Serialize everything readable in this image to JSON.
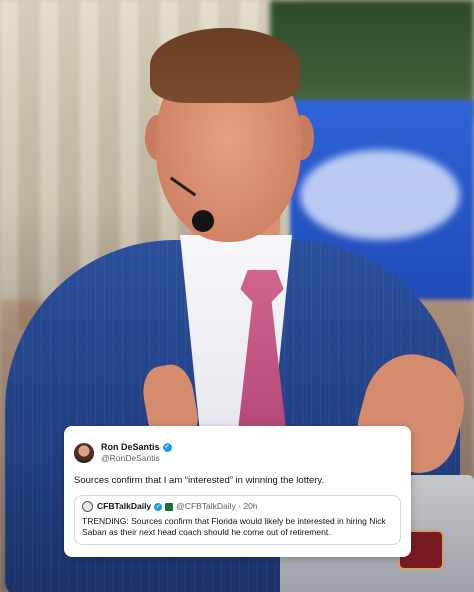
{
  "tweet": {
    "author_name": "Ron DeSantis",
    "author_handle": "@RonDeSantis",
    "text": "Sources confirm that I am “interested” in winning the lottery.",
    "verified_glyph": "✓",
    "quoted": {
      "author_name": "CFBTalkDaily",
      "meta": "@CFBTalkDaily · 20h",
      "verified_glyph": "✓",
      "text": "TRENDING: Sources confirm that Florida   would likely be interested in hiring Nick Saban as their next head coach should he come out of retirement."
    }
  },
  "colors": {
    "suit": "#213f82",
    "tie": "#c0578a",
    "verified": "#1d9bf0",
    "card": "#ffffff"
  }
}
